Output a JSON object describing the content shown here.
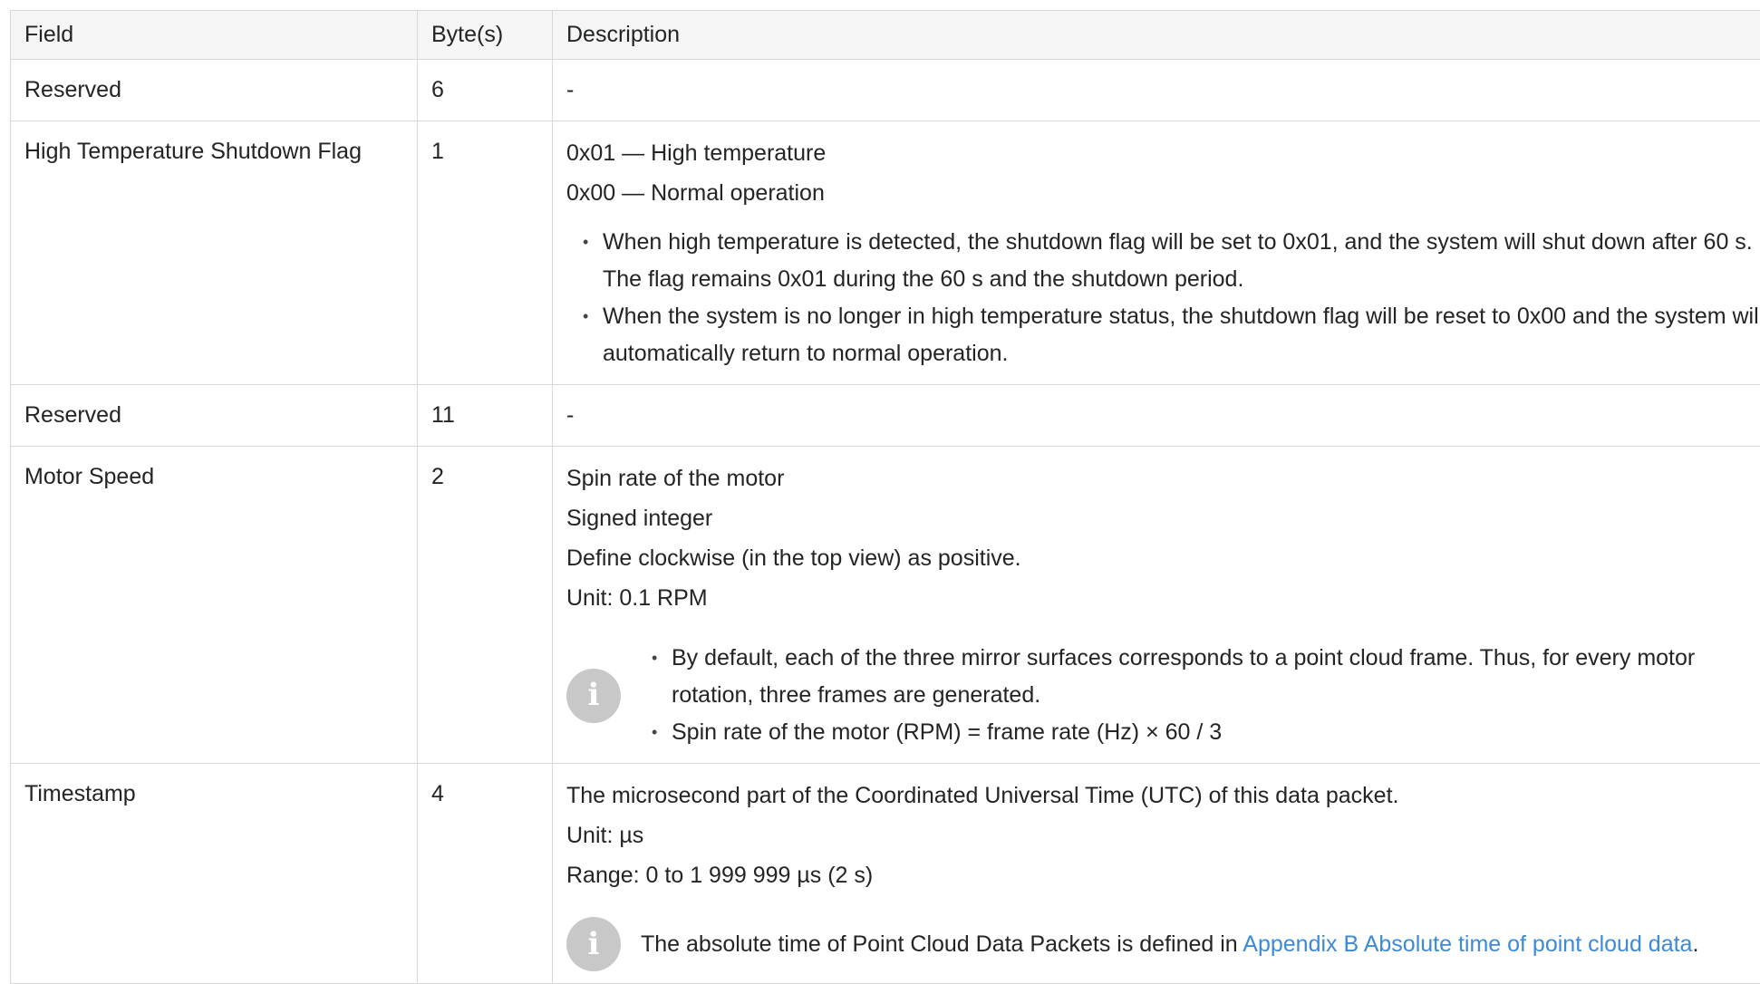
{
  "table": {
    "headers": [
      "Field",
      "Byte(s)",
      "Description"
    ],
    "rows": {
      "reserved1": {
        "field": "Reserved",
        "bytes": "6",
        "desc": "-"
      },
      "high_temp": {
        "field": "High Temperature Shutdown Flag",
        "bytes": "1",
        "lines": [
          "0x01 — High temperature",
          "0x00 — Normal operation"
        ],
        "bullets": [
          "When high temperature is detected, the shutdown flag will be set to 0x01, and the system will shut down after 60 s. The flag remains 0x01 during the 60 s and the shutdown period.",
          "When the system is no longer in high temperature status, the shutdown flag will be reset to 0x00 and the system will automatically return to normal operation."
        ]
      },
      "reserved2": {
        "field": "Reserved",
        "bytes": "11",
        "desc": "-"
      },
      "motor_speed": {
        "field": "Motor Speed",
        "bytes": "2",
        "lines": [
          "Spin rate of the motor",
          "Signed integer",
          "Define clockwise (in the top view) as positive.",
          "Unit: 0.1 RPM"
        ],
        "note_bullets": [
          "By default, each of the three mirror surfaces corresponds to a point cloud frame. Thus, for every motor rotation, three frames are generated.",
          "Spin rate of the motor (RPM) = frame rate (Hz) × 60 / 3"
        ]
      },
      "timestamp": {
        "field": "Timestamp",
        "bytes": "4",
        "lines": [
          "The microsecond part of the Coordinated Universal Time (UTC) of this data packet.",
          "Unit: µs",
          "Range: 0 to 1 999 999 µs (2 s)"
        ],
        "note_prefix": "The absolute time of Point Cloud Data Packets is defined in ",
        "note_link": "Appendix B Absolute time of point cloud data",
        "note_suffix": "."
      }
    }
  },
  "icons": {
    "info": "info-icon"
  },
  "colors": {
    "link": "#3d8ad6",
    "border": "#d8d8d8",
    "header_bg": "#f5f5f5",
    "icon_bg": "#c8c8c8"
  }
}
